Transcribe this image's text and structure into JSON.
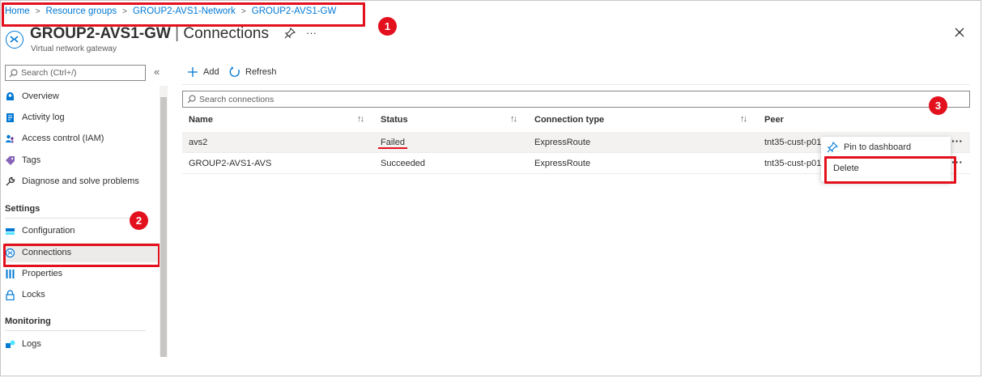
{
  "breadcrumb": {
    "items": [
      "Home",
      "Resource groups",
      "GROUP2-AVS1-Network",
      "GROUP2-AVS1-GW"
    ],
    "separator": ">"
  },
  "header": {
    "resource_name": "GROUP2-AVS1-GW",
    "divider": "|",
    "page_name": "Connections",
    "subtitle": "Virtual network gateway",
    "more": "···"
  },
  "sidebar": {
    "search_placeholder": "Search (Ctrl+/)",
    "collapse": "«",
    "items": [
      {
        "label": "Overview",
        "icon": "overview-icon"
      },
      {
        "label": "Activity log",
        "icon": "activity-log-icon"
      },
      {
        "label": "Access control (IAM)",
        "icon": "iam-icon"
      },
      {
        "label": "Tags",
        "icon": "tag-icon"
      },
      {
        "label": "Diagnose and solve problems",
        "icon": "wrench-icon"
      }
    ],
    "settings_heading": "Settings",
    "settings_items": [
      {
        "label": "Configuration",
        "icon": "configuration-icon"
      },
      {
        "label": "Connections",
        "icon": "connections-icon",
        "selected": true
      },
      {
        "label": "Properties",
        "icon": "properties-icon"
      },
      {
        "label": "Locks",
        "icon": "lock-icon"
      }
    ],
    "monitoring_heading": "Monitoring",
    "monitoring_items": [
      {
        "label": "Logs",
        "icon": "logs-icon"
      }
    ]
  },
  "toolbar": {
    "add_label": "Add",
    "refresh_label": "Refresh"
  },
  "search": {
    "placeholder": "Search connections"
  },
  "table": {
    "columns": [
      "Name",
      "Status",
      "Connection type",
      "Peer"
    ],
    "rows": [
      {
        "name": "avs2",
        "status": "Failed",
        "type": "ExpressRoute",
        "peer": "tnt35-cust-p01"
      },
      {
        "name": "GROUP2-AVS1-AVS",
        "status": "Succeeded",
        "type": "ExpressRoute",
        "peer": "tnt35-cust-p01"
      }
    ],
    "row_more": "···"
  },
  "context_menu": {
    "items": [
      "Pin to dashboard",
      "Delete"
    ]
  },
  "callouts": [
    "1",
    "2",
    "3"
  ],
  "colors": {
    "accent": "#0078d4",
    "highlight": "#e3101e",
    "selected_bg": "#edebe9"
  }
}
